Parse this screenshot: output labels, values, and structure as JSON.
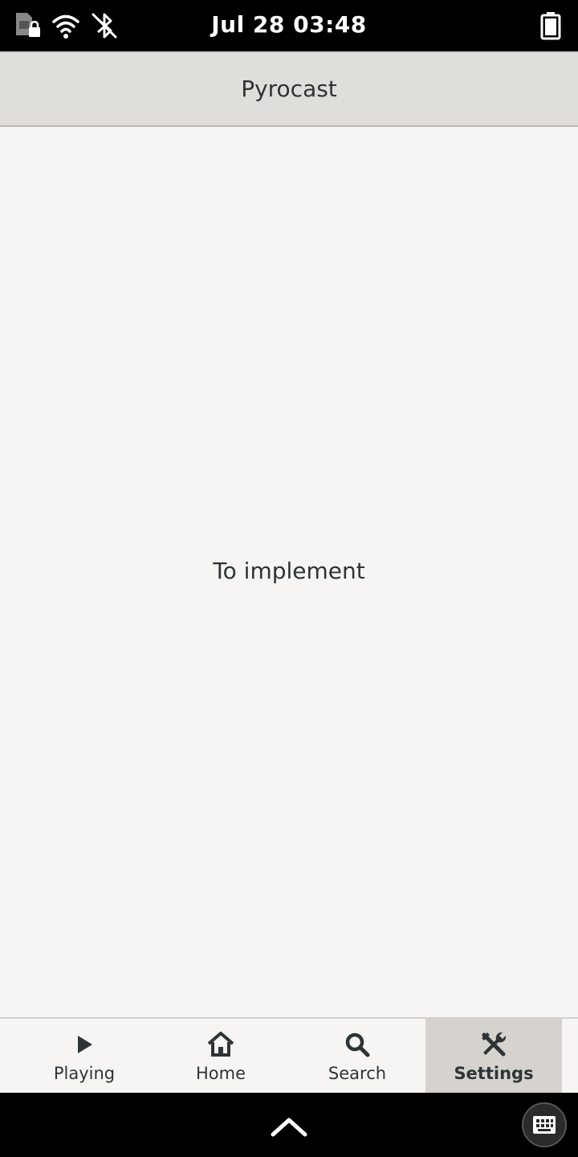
{
  "status_bar": {
    "datetime": "Jul 28  03:48",
    "icons": [
      "sim-locked-icon",
      "wifi-icon",
      "bluetooth-disabled-icon",
      "battery-icon"
    ]
  },
  "header": {
    "title": "Pyrocast"
  },
  "content": {
    "placeholder": "To implement"
  },
  "tabs": [
    {
      "label": "Playing",
      "icon": "play-icon",
      "active": false
    },
    {
      "label": "Home",
      "icon": "home-icon",
      "active": false
    },
    {
      "label": "Search",
      "icon": "search-icon",
      "active": false
    },
    {
      "label": "Settings",
      "icon": "settings-tools-icon",
      "active": true
    }
  ],
  "nav_bar": {
    "icons": [
      "chevron-up-icon",
      "keyboard-icon"
    ]
  },
  "colors": {
    "background": "#f6f5f4",
    "header": "#e0dedb",
    "active_tab": "#d6d3cf",
    "text": "#2e3436"
  }
}
